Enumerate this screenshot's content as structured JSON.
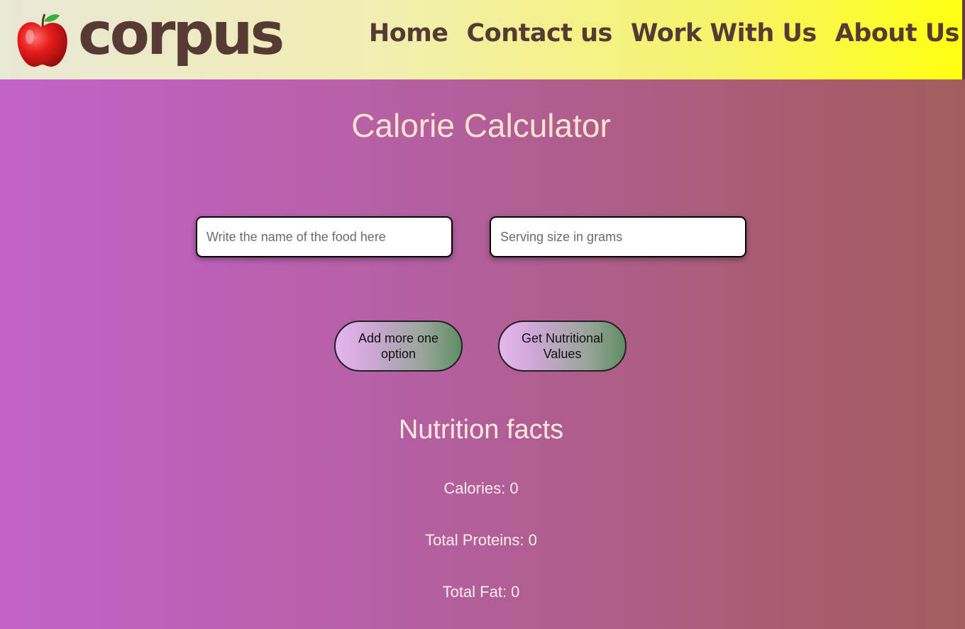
{
  "header": {
    "brand": "corpus",
    "nav": [
      "Home",
      "Contact us",
      "Work With Us",
      "About Us"
    ]
  },
  "main": {
    "title": "Calorie Calculator",
    "food_input": {
      "placeholder": "Write the name of the food here",
      "value": ""
    },
    "grams_input": {
      "placeholder": "Serving size in grams",
      "value": ""
    },
    "buttons": {
      "add_option": "Add more one option",
      "get_values": "Get Nutritional Values"
    }
  },
  "facts": {
    "heading": "Nutrition facts",
    "calories": "Calories: 0",
    "proteins": "Total Proteins: 0",
    "fat": "Total Fat: 0"
  },
  "colors": {
    "brand_text": "#573a34",
    "title_text": "#fde2cf",
    "header_start": "#e9e7d6",
    "header_end": "#ffff10",
    "background_start": "#c262c9",
    "background_end": "#a35d5f"
  },
  "icons": {
    "logo": "red-apple-icon"
  }
}
